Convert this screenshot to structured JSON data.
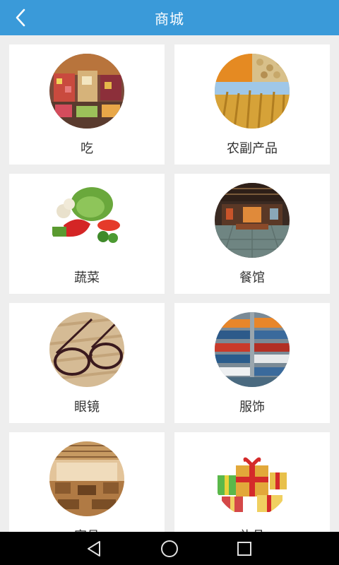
{
  "header": {
    "title": "商城",
    "background": "#3a9ad9",
    "back_icon": "chevron-left-icon"
  },
  "categories": [
    {
      "label": "吃",
      "image": "market-photo"
    },
    {
      "label": "农副产品",
      "image": "grain-wheat-photo"
    },
    {
      "label": "蔬菜",
      "image": "vegetables-photo"
    },
    {
      "label": "餐馆",
      "image": "restaurant-photo"
    },
    {
      "label": "眼镜",
      "image": "eyeglasses-photo"
    },
    {
      "label": "服饰",
      "image": "clothing-shelf-photo"
    },
    {
      "label": "家具",
      "image": "furniture-room-photo"
    },
    {
      "label": "礼品",
      "image": "gift-boxes-photo"
    }
  ],
  "system_nav": {
    "back_icon": "triangle-back-icon",
    "home_icon": "circle-home-icon",
    "recents_icon": "square-recents-icon"
  }
}
